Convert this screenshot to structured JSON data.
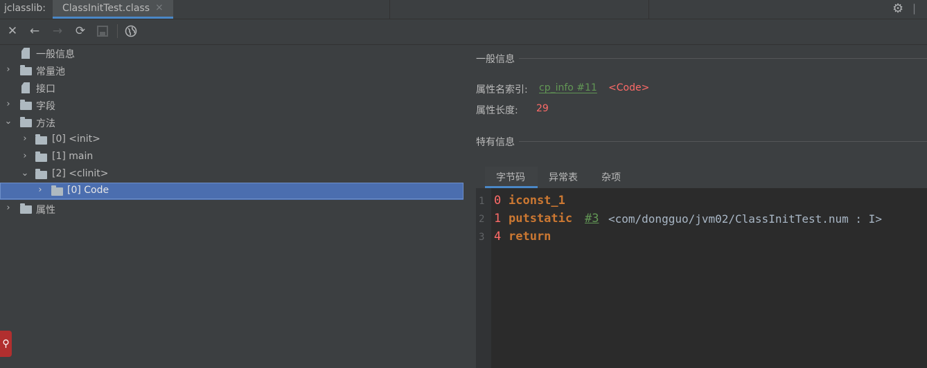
{
  "app": {
    "title": "jclasslib:"
  },
  "tab": {
    "label": "ClassInitTest.class",
    "close": "×"
  },
  "tree": {
    "items": [
      {
        "label": "一般信息"
      },
      {
        "label": "常量池"
      },
      {
        "label": "接口"
      },
      {
        "label": "字段"
      },
      {
        "label": "方法"
      },
      {
        "label": "[0] <init>"
      },
      {
        "label": "[1] main"
      },
      {
        "label": "[2] <clinit>"
      },
      {
        "label": "[0] Code"
      },
      {
        "label": "属性"
      }
    ]
  },
  "general": {
    "title": "一般信息",
    "name_index_label": "属性名索引:",
    "name_index_link": "cp_info #11",
    "name_index_value": "<Code>",
    "length_label": "属性长度:",
    "length_value": "29"
  },
  "specific": {
    "title": "特有信息"
  },
  "subtabs": [
    {
      "label": "字节码"
    },
    {
      "label": "异常表"
    },
    {
      "label": "杂项"
    }
  ],
  "bytecode": [
    {
      "line": "1",
      "offset": "0",
      "op": "iconst_1",
      "ref": "",
      "comment": ""
    },
    {
      "line": "2",
      "offset": "1",
      "op": "putstatic",
      "ref": "#3",
      "comment": "<com/dongguo/jvm02/ClassInitTest.num : I>"
    },
    {
      "line": "3",
      "offset": "4",
      "op": "return",
      "ref": "",
      "comment": ""
    }
  ]
}
